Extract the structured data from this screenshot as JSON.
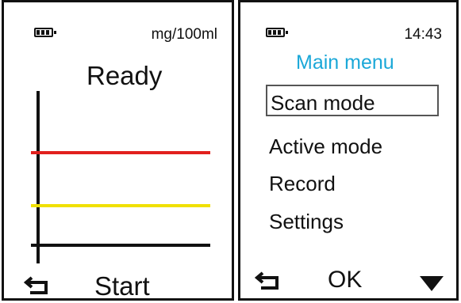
{
  "left_screen": {
    "unit_label": "mg/100ml",
    "status_text": "Ready",
    "start_label": "Start",
    "battery_icon": "battery-icon",
    "back_icon": "back-arrow-icon",
    "graph": {
      "red_line_color": "#e1201d",
      "yellow_line_color": "#f0e000",
      "axis_color": "#111111"
    }
  },
  "right_screen": {
    "time": "14:43",
    "title": "Main menu",
    "title_color": "#1ba8d8",
    "menu_items": [
      "Scan mode",
      "Active mode",
      "Record",
      "Settings"
    ],
    "selected_index": 0,
    "ok_label": "OK",
    "battery_icon": "battery-icon",
    "back_icon": "back-arrow-icon",
    "down_icon": "down-arrow-icon"
  }
}
